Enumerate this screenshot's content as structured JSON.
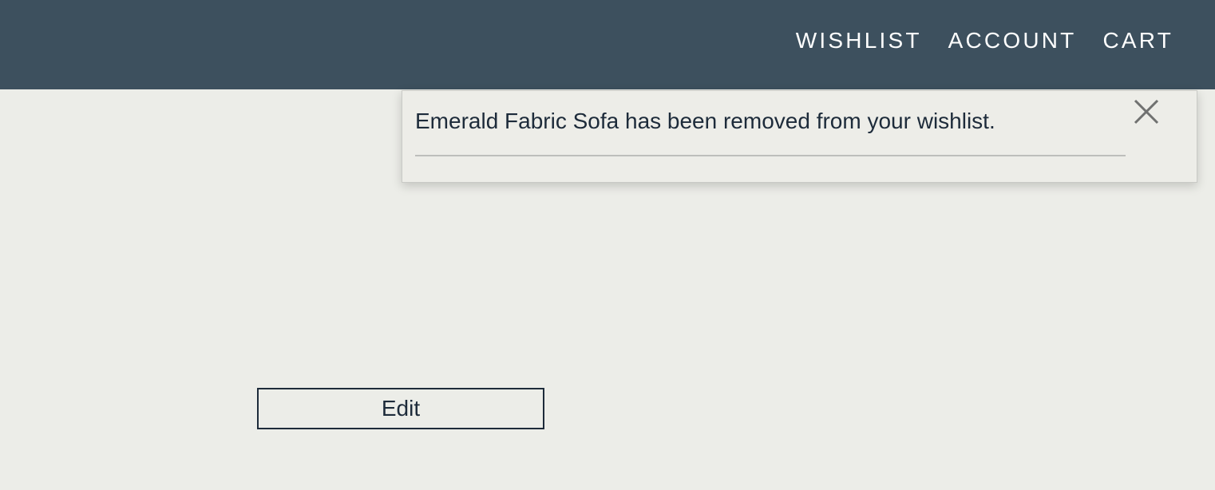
{
  "header": {
    "nav": [
      {
        "label": "WISHLIST"
      },
      {
        "label": "ACCOUNT"
      },
      {
        "label": "CART"
      }
    ]
  },
  "notification": {
    "message": "Emerald Fabric Sofa has been removed from your wishlist.",
    "close_icon": "close-icon"
  },
  "main": {
    "edit_label": "Edit"
  },
  "colors": {
    "header_bg": "#3d505e",
    "page_bg": "#ecede8",
    "text": "#1d2b3a"
  }
}
